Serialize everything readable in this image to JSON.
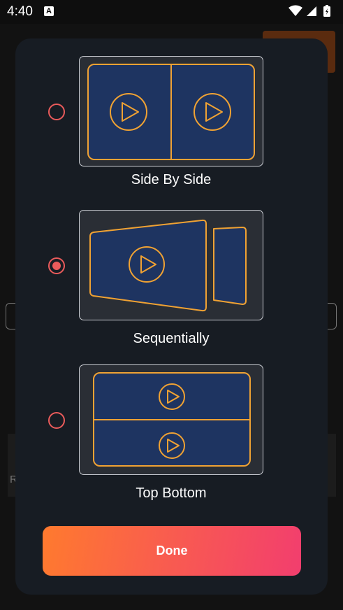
{
  "status_bar": {
    "time": "4:40",
    "icons": [
      "a-notification-icon",
      "wifi-icon",
      "cellular-signal-icon",
      "battery-icon"
    ]
  },
  "dialog": {
    "options": [
      {
        "label": "Side By Side",
        "selected": false,
        "icon": "side-by-side-layout-icon"
      },
      {
        "label": "Sequentially",
        "selected": true,
        "icon": "sequential-layout-icon"
      },
      {
        "label": "Top Bottom",
        "selected": false,
        "icon": "top-bottom-layout-icon"
      }
    ],
    "done_label": "Done"
  },
  "background": {
    "partial_letter": "R"
  },
  "colors": {
    "dialog_bg": "#171c23",
    "preview_bg": "#2a2e35",
    "panel_fill": "#1e3461",
    "accent_outline": "#f0a233",
    "radio": "#ea5b5b",
    "button_gradient_start": "#ff7a2e",
    "button_gradient_end": "#f23e6e"
  }
}
